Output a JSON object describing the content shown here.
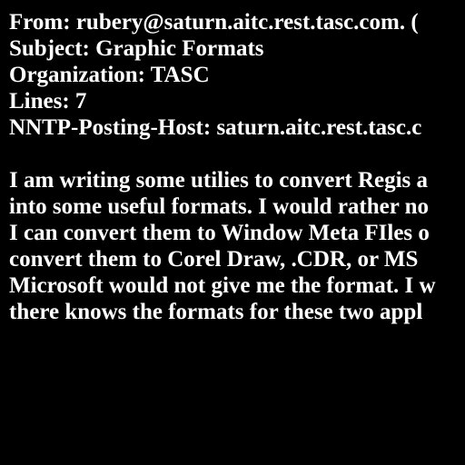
{
  "colors": {
    "background": "#000000",
    "text": "#ffffff"
  },
  "headers": {
    "from": "From: rubery@saturn.aitc.rest.tasc.com. (",
    "subject": "Subject: Graphic Formats",
    "organization": "Organization: TASC",
    "lines": "Lines: 7",
    "nntp_posting_host": "NNTP-Posting-Host: saturn.aitc.rest.tasc.c"
  },
  "body_lines": [
    "I am writing some utilies to convert Regis a",
    "into some useful formats. I would rather no",
    "I can convert them to Window Meta FIles o",
    "convert them to Corel Draw, .CDR, or MS",
    "Microsoft would not give me the format. I w",
    "there knows the formats for these two appl"
  ]
}
